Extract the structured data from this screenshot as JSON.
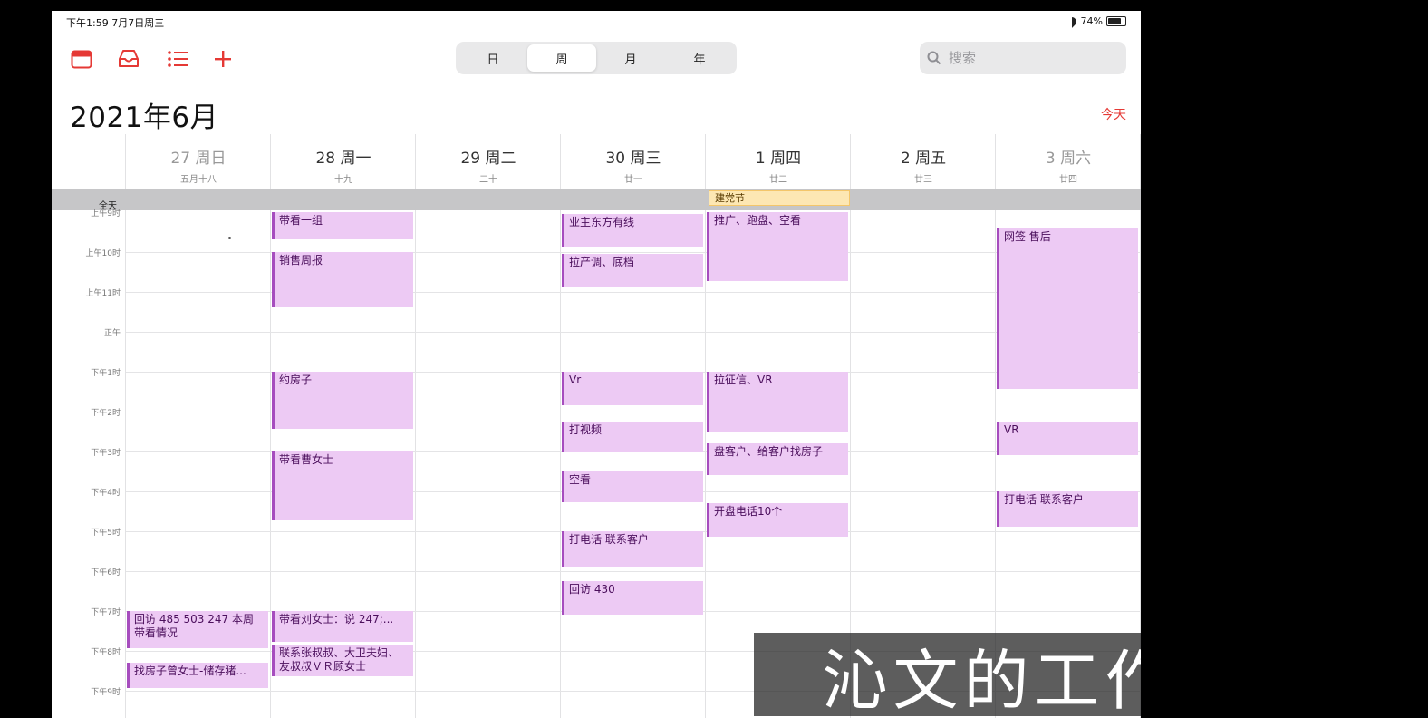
{
  "status_bar": {
    "time_date": "下午1:59  7月7日周三",
    "battery": "74%"
  },
  "toolbar": {
    "views": [
      {
        "label": "日"
      },
      {
        "label": "周",
        "selected": true
      },
      {
        "label": "月"
      },
      {
        "label": "年"
      }
    ],
    "search_placeholder": "搜索",
    "today_label": "今天"
  },
  "title": "2021年6月",
  "days": [
    {
      "date": "27 周日",
      "lunar": "五月十八",
      "weekend": true
    },
    {
      "date": "28 周一",
      "lunar": "十九"
    },
    {
      "date": "29 周二",
      "lunar": "二十"
    },
    {
      "date": "30 周三",
      "lunar": "廿一"
    },
    {
      "date": "1 周四",
      "lunar": "廿二"
    },
    {
      "date": "2 周五",
      "lunar": "廿三"
    },
    {
      "date": "3 周六",
      "lunar": "廿四",
      "weekend": true
    }
  ],
  "allday_label": "全天",
  "allday_event": "建党节",
  "time_labels": [
    "上午9时",
    "上午10时",
    "上午11时",
    "正午",
    "下午1时",
    "下午2时",
    "下午3时",
    "下午4时",
    "下午5时",
    "下午6时",
    "下午7时",
    "下午8时",
    "下午9时"
  ],
  "events": [
    {
      "day": 1,
      "start": 9.0,
      "end": 9.75,
      "title": "带看一组"
    },
    {
      "day": 1,
      "start": 10.0,
      "end": 11.45,
      "title": "销售周报"
    },
    {
      "day": 1,
      "start": 13.0,
      "end": 14.5,
      "title": "约房子"
    },
    {
      "day": 1,
      "start": 15.0,
      "end": 16.8,
      "title": "带看曹女士"
    },
    {
      "day": 1,
      "start": 19.0,
      "end": 19.85,
      "title": "带看刘女士：说 247;..."
    },
    {
      "day": 1,
      "start": 19.85,
      "end": 20.7,
      "title": "联系张叔叔、大卫夫妇、友叔叔ＶＲ顾女士"
    },
    {
      "day": 0,
      "start": 19.0,
      "end": 20.0,
      "title": "回访 485 503 247 本周带看情况"
    },
    {
      "day": 0,
      "start": 20.3,
      "end": 21.0,
      "title": "找房子曾女士-储存猪..."
    },
    {
      "day": 3,
      "start": 9.05,
      "end": 9.95,
      "title": "业主东方有线"
    },
    {
      "day": 3,
      "start": 10.05,
      "end": 10.95,
      "title": "拉产调、底档"
    },
    {
      "day": 3,
      "start": 13.0,
      "end": 13.9,
      "title": "Vr"
    },
    {
      "day": 3,
      "start": 14.25,
      "end": 15.1,
      "title": "打视频"
    },
    {
      "day": 3,
      "start": 15.5,
      "end": 16.35,
      "title": "空看"
    },
    {
      "day": 3,
      "start": 17.0,
      "end": 17.95,
      "title": "打电话 联系客户"
    },
    {
      "day": 3,
      "start": 18.25,
      "end": 19.15,
      "title": "回访 430"
    },
    {
      "day": 4,
      "start": 9.0,
      "end": 10.8,
      "title": "推广、跑盘、空看"
    },
    {
      "day": 4,
      "start": 13.0,
      "end": 14.6,
      "title": "拉征信、VR"
    },
    {
      "day": 4,
      "start": 14.8,
      "end": 15.65,
      "title": "盘客户、给客户找房子"
    },
    {
      "day": 4,
      "start": 16.3,
      "end": 17.2,
      "title": "开盘电话10个"
    },
    {
      "day": 6,
      "start": 9.4,
      "end": 13.5,
      "title": "网签 售后"
    },
    {
      "day": 6,
      "start": 14.25,
      "end": 15.15,
      "title": "VR"
    },
    {
      "day": 6,
      "start": 16.0,
      "end": 16.95,
      "title": "打电话 联系客户"
    }
  ],
  "caption": "沁文的工作日历",
  "colors": {
    "accent": "#e53935",
    "event_fill": "#edcaf4",
    "event_bar": "#a64dbe",
    "holiday_fill": "#fde7b3"
  }
}
